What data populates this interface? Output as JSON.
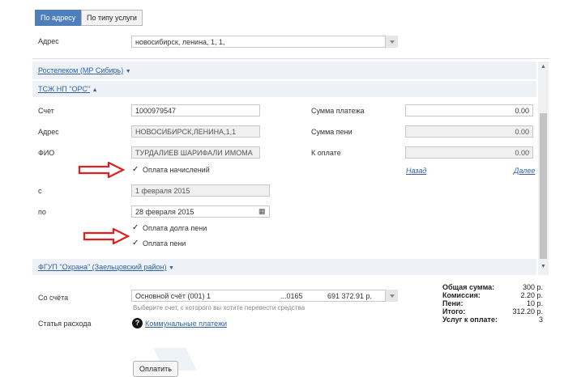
{
  "tabs": {
    "by_address": "По адресу",
    "by_service": "По типу услуги"
  },
  "address_row": {
    "label": "Адрес",
    "value": "новосибирск, ленина, 1, 1,"
  },
  "provider1": {
    "label": "Ростелеком (МР Сибирь)",
    "chevron": "▼"
  },
  "provider2": {
    "label": "ТСЖ НП \"ОРС\"",
    "chevron": "▲"
  },
  "form": {
    "account_label": "Счет",
    "account_value": "1000979547",
    "address_label": "Адрес",
    "address_value": "НОВОСИБИРСК,ЛЕНИНА,1,1",
    "fio_label": "ФИО",
    "fio_value": "ТУРДАЛИЕВ ШАРИФАЛИ ИМОМА",
    "pay_accruals_label": "Оплата начислений",
    "from_label": "с",
    "from_value": "1 февраля 2015",
    "to_label": "по",
    "to_value": "28 февраля 2015",
    "pay_penalty_debt_label": "Оплата долга пени",
    "pay_penalty_label": "Оплата пени",
    "payment_sum_label": "Сумма платежа",
    "payment_sum_value": "0.00",
    "penalty_sum_label": "Сумма пени",
    "penalty_sum_value": "0.00",
    "to_pay_label": "К оплате",
    "to_pay_value": "0.00",
    "back_link": "Назад",
    "next_link": "Далее"
  },
  "provider3": {
    "label": "ФГУП \"Охрана\" (Заельцовский район)",
    "chevron": "▼"
  },
  "from_account": {
    "label": "Со счёта",
    "name": "Основной счёт (001) 1",
    "number": "...0165",
    "balance": "691 372.91 р.",
    "hint": "Выберите счет, с которого вы хотите перевести средства"
  },
  "expense": {
    "label": "Статья расхода",
    "link": "Коммунальные платежи",
    "help_glyph": "?"
  },
  "summary": {
    "total_label": "Общая сумма:",
    "total_value": "300 р.",
    "fee_label": "Комиссия:",
    "fee_value": "2.20 р.",
    "penalty_label": "Пени:",
    "penalty_value": "10 р.",
    "grand_label": "Итого:",
    "grand_value": "312.20 р.",
    "services_label": "Услуг к оплате:",
    "services_value": "3"
  },
  "pay_button": "Оплатить",
  "colors": {
    "tab_active": "#4e7fba",
    "band": "#eef2f6",
    "link": "#2f63a6",
    "arrow": "#e02020"
  }
}
